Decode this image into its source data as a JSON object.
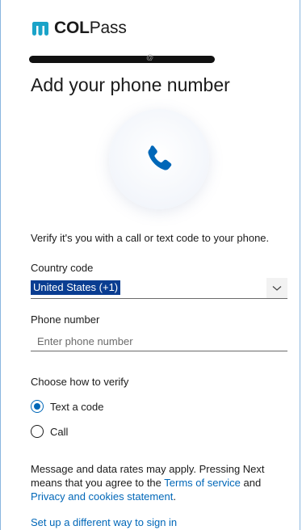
{
  "brand": {
    "name_bold": "COL",
    "name_rest": "Pass"
  },
  "page": {
    "title": "Add your phone number"
  },
  "description": "Verify it's you with a call or text code to your phone.",
  "country": {
    "label": "Country code",
    "selected": "United States (+1)"
  },
  "phone": {
    "label": "Phone number",
    "placeholder": "Enter phone number"
  },
  "verify": {
    "label": "Choose how to verify",
    "options": [
      {
        "label": "Text a code",
        "checked": true
      },
      {
        "label": "Call",
        "checked": false
      }
    ]
  },
  "notice": {
    "prefix": "Message and data rates may apply. Pressing Next means that you agree to the ",
    "terms_link": "Terms of service",
    "and_text": " and ",
    "privacy_link": "Privacy and cookies statement",
    "suffix": "."
  },
  "alt_link": "Set up a different way to sign in",
  "colors": {
    "accent": "#0067b8",
    "selection": "#0a3d91",
    "brand_teal": "#1aa3c8"
  },
  "icons": {
    "brand": "colpass-logo-icon",
    "phone": "phone-icon",
    "chevron": "chevron-down-icon"
  }
}
